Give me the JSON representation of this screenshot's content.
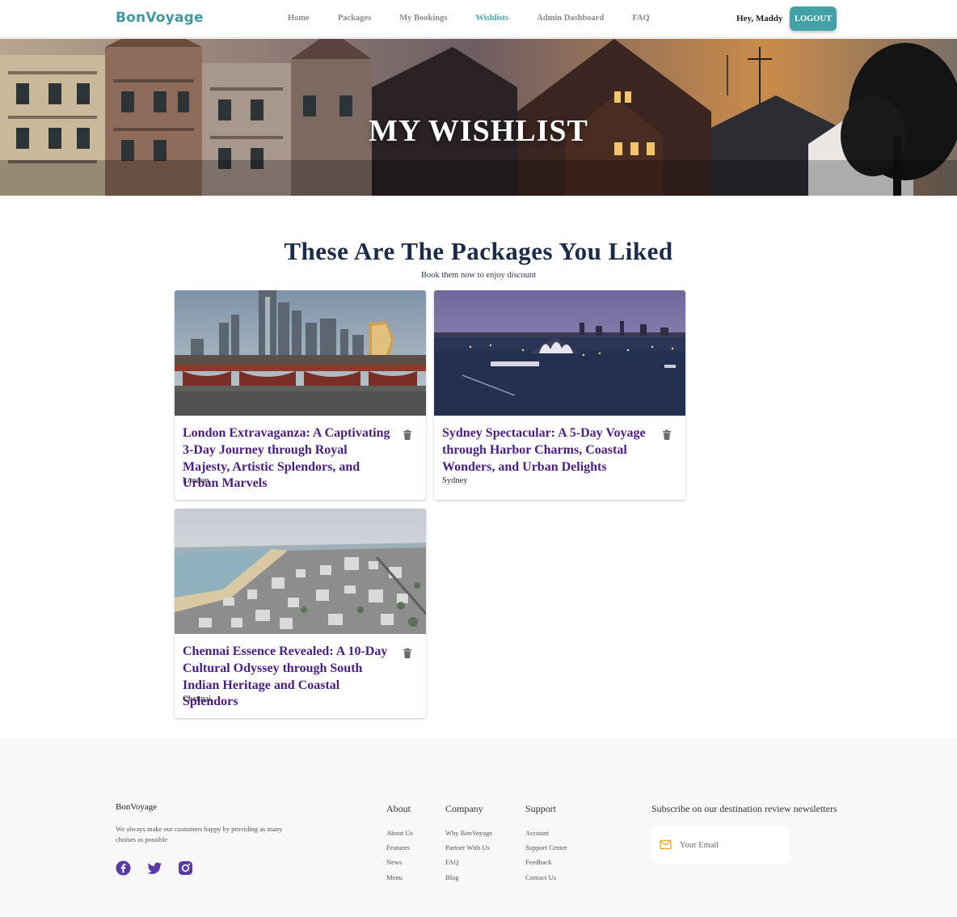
{
  "nav": {
    "brand": "BonVoyage",
    "links": [
      "Home",
      "Packages",
      "My Bookings",
      "Wishlists",
      "Admin Dashboard",
      "FAQ"
    ],
    "active_link": "Wishlists",
    "greeting": "Hey, Maddy",
    "logout_label": "LOGOUT"
  },
  "hero": {
    "title": "MY WISHLIST"
  },
  "section": {
    "title": "These Are The Packages You Liked",
    "subtitle": "Book them now to enjoy discount"
  },
  "packages": [
    {
      "title": "London Extravaganza: A Captivating 3-Day Journey through Royal Majesty, Artistic Splendors, and Urban Marvels",
      "location": "London"
    },
    {
      "title": "Sydney Spectacular: A 5-Day Voyage through Harbor Charms, Coastal Wonders, and Urban Delights",
      "location": "Sydney"
    },
    {
      "title": "Chennai Essence Revealed: A 10-Day Cultural Odyssey through South Indian Heritage and Coastal Splendors",
      "location": "Chennai"
    }
  ],
  "footer": {
    "brand": "BonVoyage",
    "description": "We always make our customers happy by providing as many choises as possible",
    "social": [
      "facebook-icon",
      "twitter-icon",
      "instagram-icon"
    ],
    "columns": [
      {
        "title": "About",
        "links": [
          "About Us",
          "Features",
          "News",
          "Menu"
        ]
      },
      {
        "title": "Company",
        "links": [
          "Why BonVoyage",
          "Partner With Us",
          "FAQ",
          "Blog"
        ]
      },
      {
        "title": "Support",
        "links": [
          "Account",
          "Support Center",
          "Feedback",
          "Contact Us"
        ]
      }
    ],
    "newsletter_title": "Subscribe on our destination review newsletters",
    "email_placeholder": "Your Email"
  },
  "colors": {
    "brand": "#3f9aa0",
    "accent": "#42a2a6",
    "card_title": "#4b1d86",
    "heading": "#1d2b4a"
  }
}
